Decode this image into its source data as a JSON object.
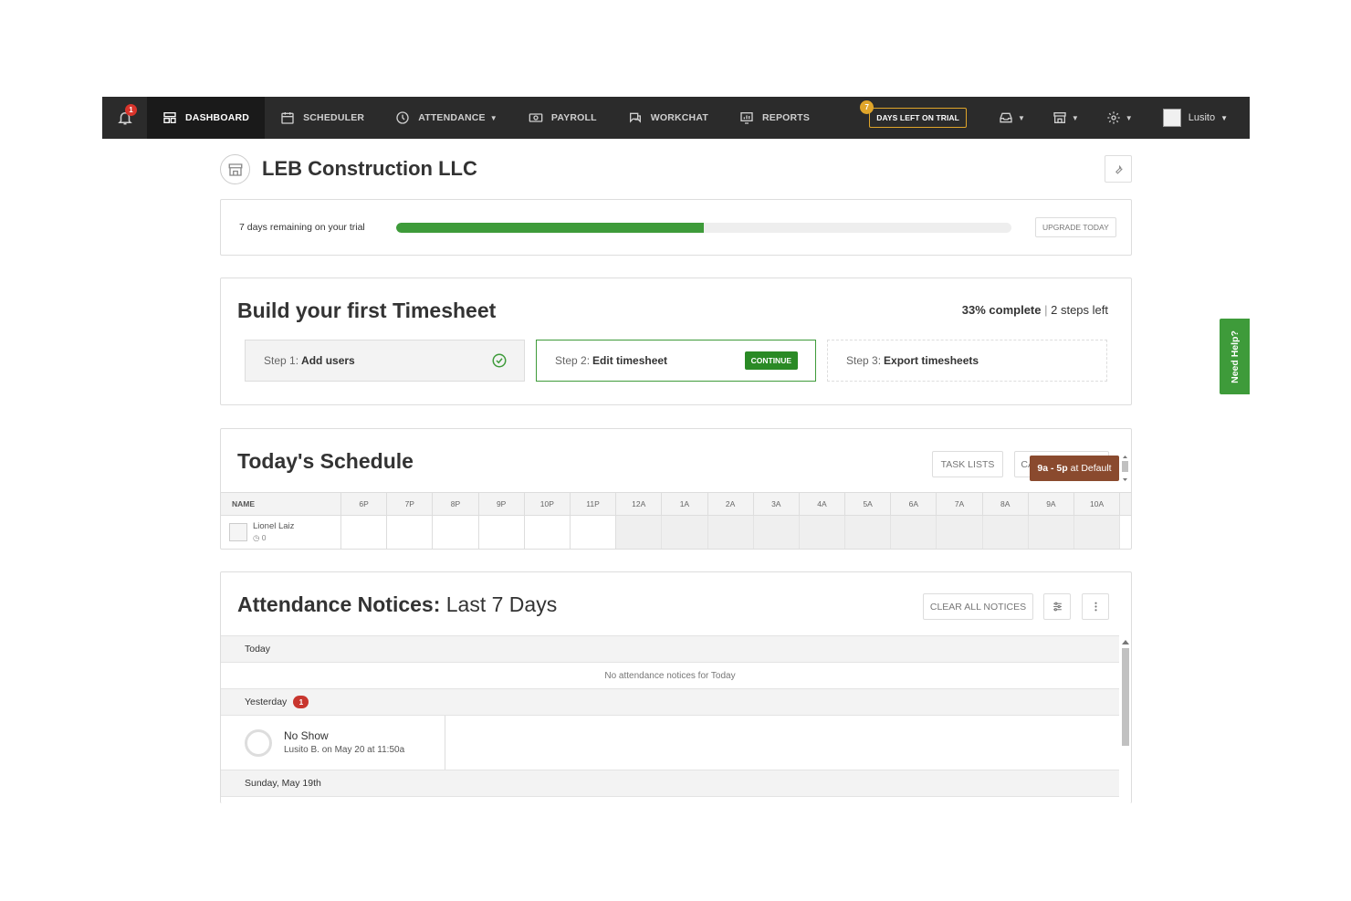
{
  "nav": {
    "notifications_count": "1",
    "items": [
      {
        "label": "DASHBOARD"
      },
      {
        "label": "SCHEDULER"
      },
      {
        "label": "ATTENDANCE"
      },
      {
        "label": "PAYROLL"
      },
      {
        "label": "WORKCHAT"
      },
      {
        "label": "REPORTS"
      }
    ],
    "trial_days": "7",
    "trial_label": "DAYS LEFT ON TRIAL",
    "user_name": "Lusito"
  },
  "company": {
    "name": "LEB Construction LLC"
  },
  "trial": {
    "text": "7 days remaining on your trial",
    "progress_fraction": 0.5,
    "upgrade_label": "UPGRADE TODAY"
  },
  "build": {
    "title": "Build your first Timesheet",
    "complete_text": "33% complete",
    "separator": "|",
    "steps_left_text": "2 steps left",
    "step1_prefix": "Step 1:",
    "step1_name": "Add users",
    "step2_prefix": "Step 2:",
    "step2_name": "Edit timesheet",
    "continue_label": "CONTINUE",
    "step3_prefix": "Step 3:",
    "step3_name": "Export timesheets"
  },
  "schedule": {
    "title": "Today's Schedule",
    "task_lists_label": "TASK LISTS",
    "calendar_sync_label": "CALENDAR SYNC",
    "name_header": "NAME",
    "hours": [
      "6P",
      "7P",
      "8P",
      "9P",
      "10P",
      "11P",
      "12A",
      "1A",
      "2A",
      "3A",
      "4A",
      "5A",
      "6A",
      "7A",
      "8A",
      "9A",
      "10A"
    ],
    "employee_name": "Lionel Laiz",
    "employee_hours": "0",
    "shift_time": "9a - 5p",
    "shift_location": "at Default"
  },
  "attendance": {
    "title_bold": "Attendance Notices:",
    "title_rest": "Last 7 Days",
    "clear_label": "CLEAR ALL NOTICES",
    "group_today": "Today",
    "today_empty": "No attendance notices for Today",
    "group_yesterday": "Yesterday",
    "yesterday_count": "1",
    "notice_title": "No Show",
    "notice_sub": "Lusito B. on May 20 at 11:50a",
    "group_sunday": "Sunday, May 19th"
  },
  "help": {
    "label": "Need Help?"
  },
  "colors": {
    "nav_bg": "#2b2b2b",
    "accent_green": "#3e9b3a",
    "trial_gold": "#e0a52a",
    "shift_brown": "#8a4a2e",
    "badge_red": "#c8362e"
  }
}
